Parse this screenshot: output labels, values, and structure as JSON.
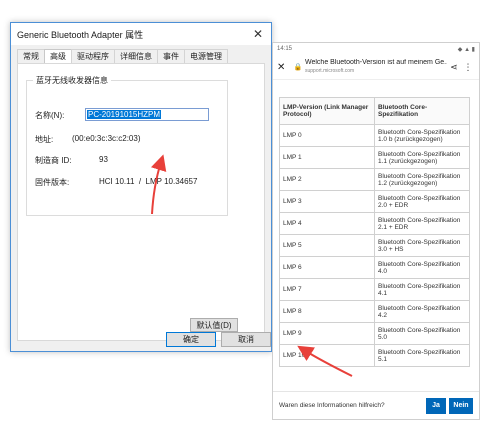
{
  "dialog": {
    "title": "Generic Bluetooth Adapter 属性",
    "tabs": [
      "常规",
      "高级",
      "驱动程序",
      "详细信息",
      "事件",
      "电源管理"
    ],
    "active_tab": "高级",
    "group_title": "蓝牙无线收发器信息",
    "name_label": "名称(N):",
    "name_value": "PC-20191015HZPM",
    "address_label": "地址:",
    "address_value": "(00:e0:3c:3c:c2:03)",
    "manufacturer_label": "制造商 ID:",
    "manufacturer_value": "93",
    "firmware_label": "固件版本:",
    "firmware_value": "HCI 10.11  /  LMP 10.34657",
    "default_button": "默认值(D)",
    "ok_button": "确定",
    "cancel_button": "取消"
  },
  "phone": {
    "time": "14:15",
    "status_icons": "◆ ▲ ▮",
    "page_title": "Welche Bluetooth-Version ist auf meinem Ge...",
    "url": "support.microsoft.com",
    "table": {
      "headers": [
        "LMP-Version (Link Manager Protocol)",
        "Bluetooth Core-Spezifikation"
      ],
      "rows": [
        [
          "LMP 0",
          "Bluetooth Core-Spezifikation 1.0 b (zurückgezogen)"
        ],
        [
          "LMP 1",
          "Bluetooth Core-Spezifikation 1.1 (zurückgezogen)"
        ],
        [
          "LMP 2",
          "Bluetooth Core-Spezifikation 1.2 (zurückgezogen)"
        ],
        [
          "LMP 3",
          "Bluetooth Core-Spezifikation 2.0 + EDR"
        ],
        [
          "LMP 4",
          "Bluetooth Core-Spezifikation 2.1 + EDR"
        ],
        [
          "LMP 5",
          "Bluetooth Core-Spezifikation 3.0 + HS"
        ],
        [
          "LMP 6",
          "Bluetooth Core-Spezifikation 4.0"
        ],
        [
          "LMP 7",
          "Bluetooth Core-Spezifikation 4.1"
        ],
        [
          "LMP 8",
          "Bluetooth Core-Spezifikation 4.2"
        ],
        [
          "LMP 9",
          "Bluetooth Core-Spezifikation 5.0"
        ],
        [
          "LMP 10",
          "Bluetooth Core-Spezifikation 5.1"
        ]
      ]
    },
    "feedback_question": "Waren diese Informationen hilfreich?",
    "yes_button": "Ja",
    "no_button": "Nein"
  },
  "colors": {
    "accent": "#0067b8",
    "annotation": "#e8403a"
  }
}
